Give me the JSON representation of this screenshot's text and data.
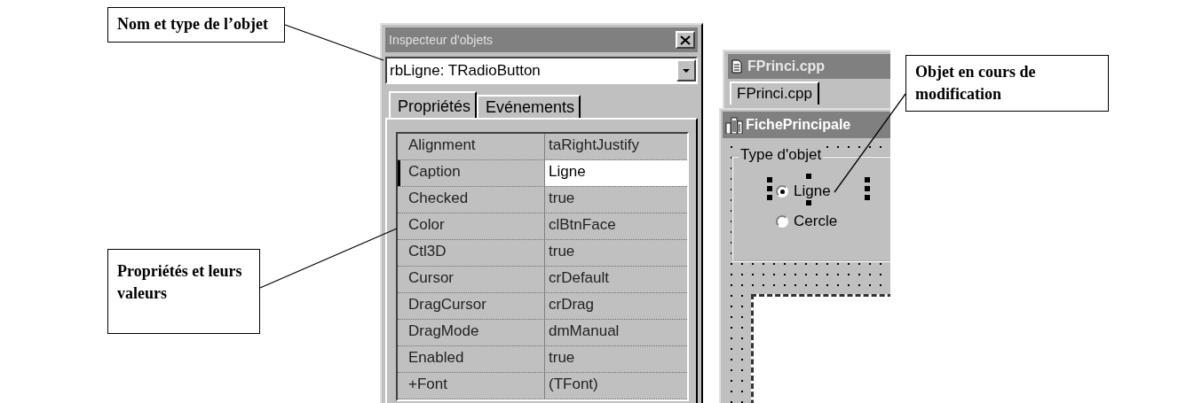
{
  "callouts": [
    {
      "text": "Nom et type de l’objet"
    },
    {
      "text": "Propriétés et leurs valeurs"
    },
    {
      "text": "Objet en cours de modification"
    }
  ],
  "inspector": {
    "title": "Inspecteur d'objets",
    "object_selector": "rbLigne: TRadioButton",
    "tabs": [
      {
        "label": "Propriétés",
        "selected": true
      },
      {
        "label": "Evénements",
        "selected": false
      }
    ],
    "properties": [
      {
        "name": "Alignment",
        "value": "taRightJustify",
        "selected": false
      },
      {
        "name": "Caption",
        "value": "Ligne",
        "selected": true
      },
      {
        "name": "Checked",
        "value": "true",
        "selected": false
      },
      {
        "name": "Color",
        "value": "clBtnFace",
        "selected": false
      },
      {
        "name": "Ctl3D",
        "value": "true",
        "selected": false
      },
      {
        "name": "Cursor",
        "value": "crDefault",
        "selected": false
      },
      {
        "name": "DragCursor",
        "value": "crDrag",
        "selected": false
      },
      {
        "name": "DragMode",
        "value": "dmManual",
        "selected": false
      },
      {
        "name": "Enabled",
        "value": "true",
        "selected": false
      },
      {
        "name": "+Font",
        "value": "(TFont)",
        "selected": false
      }
    ]
  },
  "editor": {
    "title": "FPrinci.cpp",
    "tabs": [
      {
        "label": "FPrinci.cpp",
        "selected": true
      }
    ]
  },
  "form": {
    "title": "FichePrincipale",
    "group_box": {
      "title": "Type d'objet",
      "options": [
        {
          "label": "Ligne",
          "checked": true,
          "selected": true
        },
        {
          "label": "Cercle",
          "checked": false,
          "selected": false
        }
      ]
    }
  }
}
